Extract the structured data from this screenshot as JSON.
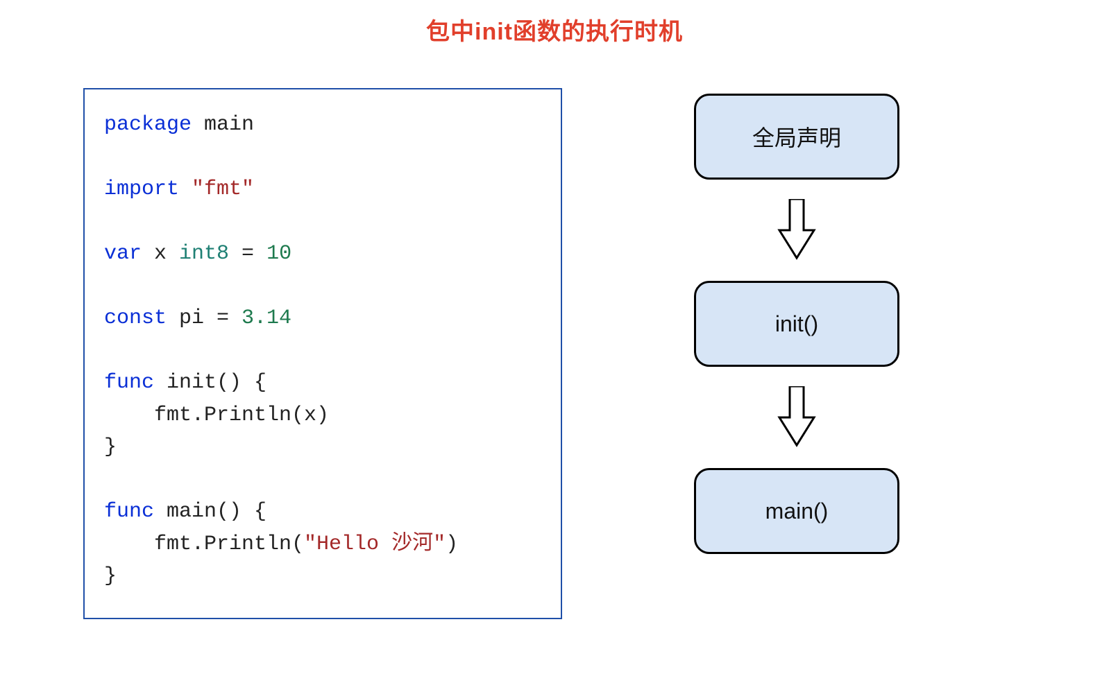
{
  "title": "包中init函数的执行时机",
  "code": {
    "l1_kw": "package",
    "l1_ident": " main",
    "l2_kw": "import",
    "l2_str": " \"fmt\"",
    "l3_kw": "var",
    "l3_name": " x ",
    "l3_type": "int8",
    "l3_eq": " = ",
    "l3_num": "10",
    "l4_kw": "const",
    "l4_name": " pi = ",
    "l4_num": "3.14",
    "l5_kw": "func",
    "l5_sig": " init() {",
    "l6_body": "    fmt.Println(x)",
    "l7_close": "}",
    "l8_kw": "func",
    "l8_sig": " main() {",
    "l9_pre": "    fmt.Println(",
    "l9_str": "\"Hello 沙河\"",
    "l9_post": ")",
    "l10_close": "}"
  },
  "flow": {
    "box1": "全局声明",
    "box2": "init()",
    "box3": "main()"
  }
}
